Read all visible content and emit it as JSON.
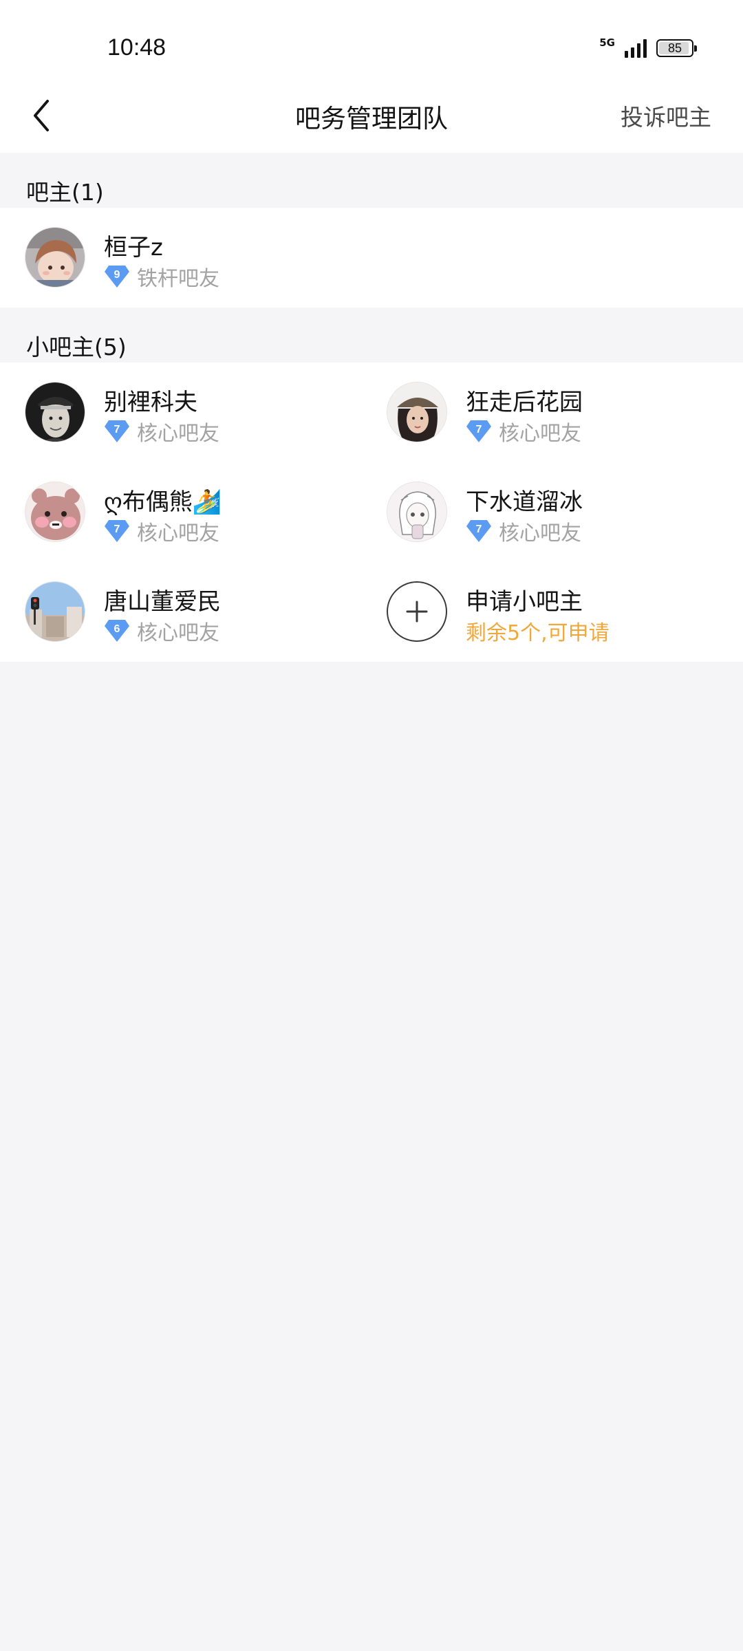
{
  "status_bar": {
    "time": "10:48",
    "network": "5G",
    "battery": "85",
    "battery_level": 0.85
  },
  "header": {
    "title": "吧务管理团队",
    "complain_label": "投诉吧主",
    "back_icon": "chevron-left-icon"
  },
  "owner_section": {
    "title": "吧主(1)",
    "members": [
      {
        "name": "桓子z",
        "level": "9",
        "role": "铁杆吧友",
        "avatar": "anime-girl-avatar"
      }
    ]
  },
  "sub_owner_section": {
    "title": "小吧主(5)",
    "members": [
      {
        "name": "别裡科夫",
        "level": "7",
        "role": "核心吧友",
        "avatar": "portrait-avatar"
      },
      {
        "name": "狂走后花园",
        "level": "7",
        "role": "核心吧友",
        "avatar": "woman-hat-avatar"
      },
      {
        "name": "ღ布偶熊🏄",
        "level": "7",
        "role": "核心吧友",
        "avatar": "pink-bear-avatar"
      },
      {
        "name": "下水道溜冰",
        "level": "7",
        "role": "核心吧友",
        "avatar": "sketch-girl-avatar"
      },
      {
        "name": "唐山董爱民",
        "level": "6",
        "role": "核心吧友",
        "avatar": "street-avatar"
      }
    ],
    "apply": {
      "title": "申请小吧主",
      "subtitle": "剩余5个,可申请",
      "icon": "plus-icon"
    }
  },
  "colors": {
    "badge": "#5b9cf2",
    "apply_text": "#f0a83a",
    "page_bg": "#f5f5f7"
  }
}
